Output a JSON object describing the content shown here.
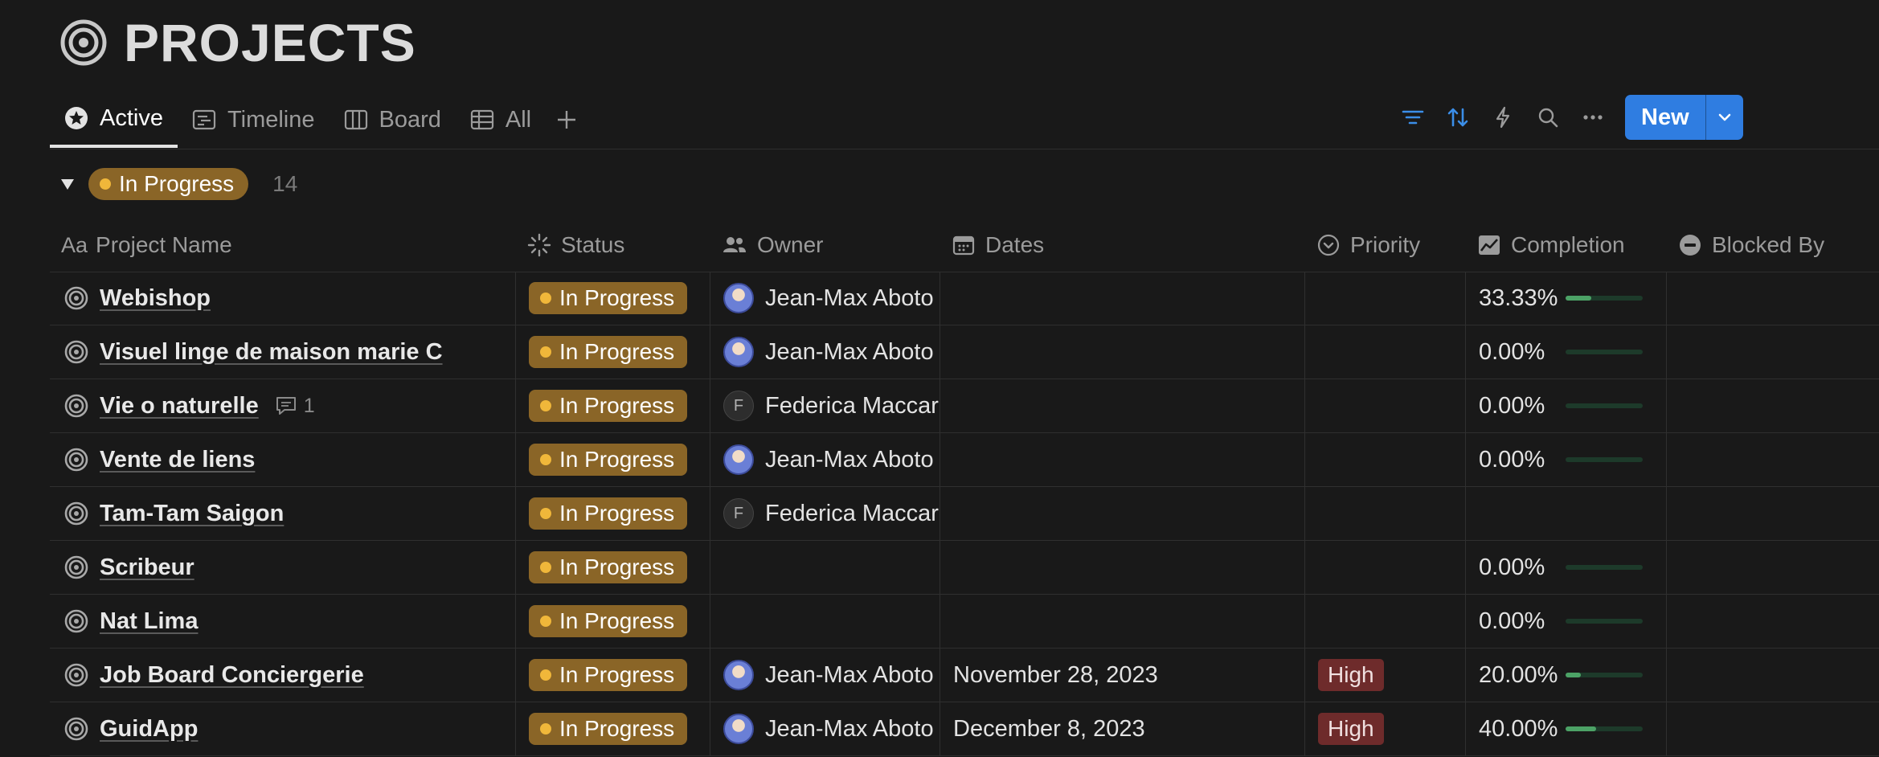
{
  "page": {
    "title": "PROJECTS"
  },
  "tabs": [
    {
      "label": "Active",
      "icon": "star-circle-icon",
      "active": true
    },
    {
      "label": "Timeline",
      "icon": "timeline-icon",
      "active": false
    },
    {
      "label": "Board",
      "icon": "board-icon",
      "active": false
    },
    {
      "label": "All",
      "icon": "table-icon",
      "active": false
    }
  ],
  "toolbar": {
    "new_label": "New",
    "accent": "#2f7de1"
  },
  "group": {
    "label": "In Progress",
    "count": "14",
    "color": "#8a6527"
  },
  "columns": {
    "name": "Project Name",
    "name_prefix": "Aa",
    "status": "Status",
    "owner": "Owner",
    "dates": "Dates",
    "priority": "Priority",
    "completion": "Completion",
    "blocked": "Blocked By"
  },
  "rows": [
    {
      "name": "Webishop",
      "status": "In Progress",
      "owner": "Jean-Max Aboto",
      "owner_avatar": "photo",
      "dates": "",
      "priority": "",
      "completion": "33.33%",
      "progress": 0.3333
    },
    {
      "name": "Visuel linge de maison marie C",
      "status": "In Progress",
      "owner": "Jean-Max Aboto",
      "owner_avatar": "photo",
      "dates": "",
      "priority": "",
      "completion": "0.00%",
      "progress": 0
    },
    {
      "name": "Vie o naturelle",
      "comments": "1",
      "status": "In Progress",
      "owner": "Federica Maccari",
      "owner_avatar": "F",
      "dates": "",
      "priority": "",
      "completion": "0.00%",
      "progress": 0
    },
    {
      "name": "Vente de liens",
      "status": "In Progress",
      "owner": "Jean-Max Aboto",
      "owner_avatar": "photo",
      "dates": "",
      "priority": "",
      "completion": "0.00%",
      "progress": 0
    },
    {
      "name": "Tam-Tam Saigon",
      "status": "In Progress",
      "owner": "Federica Maccari",
      "owner_avatar": "F",
      "dates": "",
      "priority": "",
      "completion": "",
      "progress": null
    },
    {
      "name": "Scribeur",
      "status": "In Progress",
      "owner": "",
      "owner_avatar": "",
      "dates": "",
      "priority": "",
      "completion": "0.00%",
      "progress": 0
    },
    {
      "name": "Nat Lima",
      "status": "In Progress",
      "owner": "",
      "owner_avatar": "",
      "dates": "",
      "priority": "",
      "completion": "0.00%",
      "progress": 0
    },
    {
      "name": "Job Board Conciergerie",
      "status": "In Progress",
      "owner": "Jean-Max Aboto",
      "owner_avatar": "photo",
      "dates": "November 28, 2023",
      "priority": "High",
      "completion": "20.00%",
      "progress": 0.2
    },
    {
      "name": "GuidApp",
      "status": "In Progress",
      "owner": "Jean-Max Aboto",
      "owner_avatar": "photo",
      "dates": "December 8, 2023",
      "priority": "High",
      "completion": "40.00%",
      "progress": 0.4
    }
  ]
}
